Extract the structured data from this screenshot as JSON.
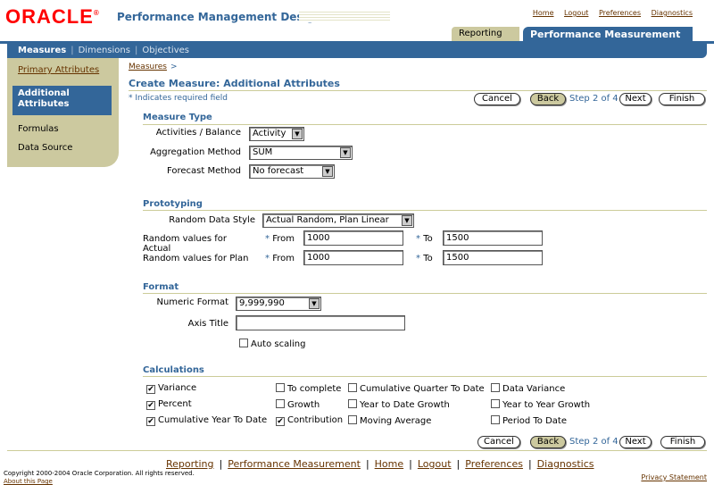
{
  "header": {
    "logo": "ORACLE",
    "logo_mark": "®",
    "app_title": "Performance Management Designer",
    "global_links": [
      "Home",
      "Logout",
      "Preferences",
      "Diagnostics"
    ],
    "tabs": [
      "Reporting",
      "Performance Measurement"
    ],
    "subtabs": [
      "Measures",
      "Dimensions",
      "Objectives"
    ]
  },
  "sidenav": {
    "items": [
      "Primary Attributes",
      "Additional Attributes",
      "Formulas",
      "Data Source"
    ]
  },
  "page": {
    "breadcrumb": "Measures",
    "breadcrumb_sep": ">",
    "title": "Create Measure: Additional Attributes",
    "required_note": "Indicates required field",
    "required_star": "*",
    "buttons": {
      "cancel": "Cancel",
      "back": "Back",
      "step": "Step 2 of 4",
      "next": "Next",
      "finish": "Finish"
    }
  },
  "measure_type": {
    "title": "Measure Type",
    "activities_label": "Activities / Balance",
    "activities_value": "Activity",
    "aggregation_label": "Aggregation Method",
    "aggregation_value": "SUM",
    "forecast_label": "Forecast Method",
    "forecast_value": "No forecast"
  },
  "prototyping": {
    "title": "Prototyping",
    "random_style_label": "Random Data Style",
    "random_style_value": "Actual Random, Plan Linear",
    "actual_label": "Random values for Actual",
    "plan_label": "Random values for Plan",
    "from_label": "From",
    "to_label": "To",
    "actual_from": "1000",
    "actual_to": "1500",
    "plan_from": "1000",
    "plan_to": "1500"
  },
  "format": {
    "title": "Format",
    "numeric_label": "Numeric Format",
    "numeric_value": "9,999,990",
    "axis_label": "Axis Title",
    "axis_value": "",
    "auto_scaling": "Auto scaling"
  },
  "calculations": {
    "title": "Calculations",
    "items": [
      {
        "label": "Variance",
        "checked": true
      },
      {
        "label": "To complete",
        "checked": false
      },
      {
        "label": "Cumulative Quarter To Date",
        "checked": false
      },
      {
        "label": "Data Variance",
        "checked": false
      },
      {
        "label": "Percent",
        "checked": true
      },
      {
        "label": "Growth",
        "checked": false
      },
      {
        "label": "Year to Date Growth",
        "checked": false
      },
      {
        "label": "Year to Year Growth",
        "checked": false
      },
      {
        "label": "Cumulative Year To Date",
        "checked": true
      },
      {
        "label": "Contribution",
        "checked": true
      },
      {
        "label": "Moving Average",
        "checked": false
      },
      {
        "label": "Period To Date",
        "checked": false
      }
    ]
  },
  "footer": {
    "links": [
      "Reporting",
      "Performance Measurement",
      "Home",
      "Logout",
      "Preferences",
      "Diagnostics"
    ],
    "link_sep": "|",
    "copyright": "Copyright 2000-2004 Oracle Corporation. All rights reserved.",
    "about": "About this Page",
    "privacy": "Privacy Statement"
  },
  "icons": {
    "check": "✔",
    "dropdown": "▼"
  },
  "colors": {
    "brand": "#336699",
    "accent": "#ccc99f",
    "logo": "#ff0000"
  }
}
